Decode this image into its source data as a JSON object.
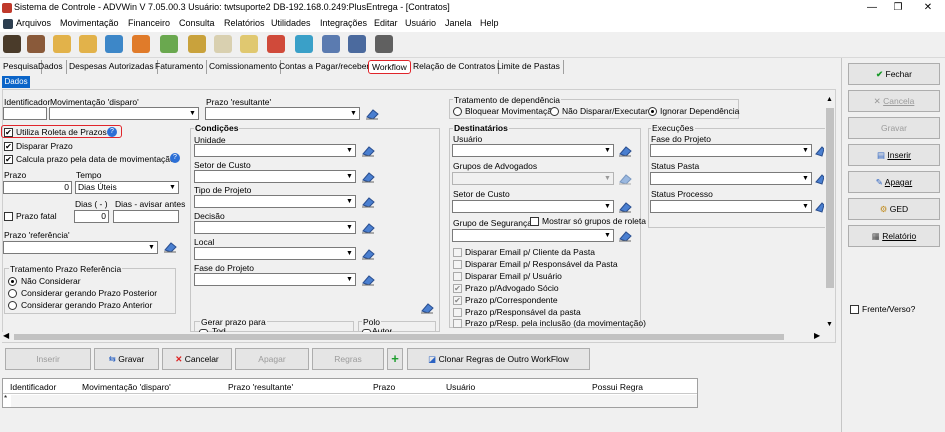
{
  "window": {
    "title": "Sistema de Controle - ADVWin  V 7.05.00.3  Usuário: twtsuporte2  DB-192.168.0.249:PlusEntrega - [Contratos]",
    "minimize": "—",
    "restore": "❐",
    "close": "✕"
  },
  "menu": [
    "Arquivos",
    "Movimentação",
    "Financeiro",
    "Consulta",
    "Relatórios",
    "Utilidades",
    "Integrações",
    "Editar",
    "Usuário",
    "Janela",
    "Help"
  ],
  "tabs": [
    "Pesquisa",
    "Dados",
    "Despesas Autorizadas",
    "Faturamento",
    "Comissionamento",
    "Contas a Pagar/receber",
    "Workflow",
    "Relação de Contratos",
    "Limite de Pastas"
  ],
  "subtab": "Dados",
  "form": {
    "identificador": "Identificador",
    "mov_disparo": "Movimentação 'disparo'",
    "prazo_resultante": "Prazo 'resultante'",
    "utiliza_roleta": "Utiliza Roleta de Prazos",
    "disparar_prazo": "Disparar Prazo",
    "calcula_prazo": "Calcula prazo pela data de movimentação",
    "prazo": "Prazo",
    "prazo_value": "0",
    "tempo": "Tempo",
    "tempo_value": "Dias Úteis",
    "dias_menos": "Dias ( - )",
    "dias_menos_value": "0",
    "dias_avisar": "Dias - avisar antes",
    "prazo_fatal": "Prazo fatal",
    "prazo_referencia": "Prazo 'referência'",
    "trat_ref_title": "Tratamento Prazo Referência",
    "trat_ref_options": [
      "Não Considerar",
      "Considerar gerando Prazo Posterior",
      "Considerar gerando Prazo Anterior"
    ]
  },
  "condicoes": {
    "title": "Condições",
    "labels": [
      "Unidade",
      "Setor de Custo",
      "Tipo de Projeto",
      "Decisão",
      "Local",
      "Fase do Projeto"
    ],
    "gerar_prazo": "Gerar prazo para",
    "gerar_first": "Tod",
    "polo": "Polo",
    "polo_first": "Autor"
  },
  "dependencia": {
    "title": "Tratamento de dependência",
    "options": [
      "Bloquear Movimentação",
      "Não Disparar/Executar",
      "Ignorar Dependência"
    ]
  },
  "destinatarios": {
    "title": "Destinatários",
    "usuario": "Usuário",
    "grupos": "Grupos de Advogados",
    "setor": "Setor de Custo",
    "grupo_seg": "Grupo de Segurança",
    "mostrar_roleta": "Mostrar só grupos de roleta",
    "checks": [
      {
        "label": "Disparar Email p/ Cliente da Pasta",
        "mark": ""
      },
      {
        "label": "Disparar Email p/ Responsável da Pasta",
        "mark": ""
      },
      {
        "label": "Disparar Email p/ Usuário",
        "mark": ""
      },
      {
        "label": "Prazo p/Advogado Sócio",
        "mark": "✔"
      },
      {
        "label": "Prazo p/Correspondente",
        "mark": "✔"
      },
      {
        "label": "Prazo p/Responsável da pasta",
        "mark": ""
      },
      {
        "label": "Prazo p/Resp. pela inclusão (da movimentação)",
        "mark": ""
      }
    ]
  },
  "execucoes": {
    "title": "Execuções",
    "labels": [
      "Fase do Projeto",
      "Status Pasta",
      "Status Processo"
    ]
  },
  "buttons": {
    "inserir": "Inserir",
    "gravar": "Gravar",
    "cancelar": "Cancelar",
    "apagar": "Apagar",
    "regras": "Regras",
    "plus": "+",
    "clonar": "Clonar Regras de Outro WorkFlow"
  },
  "grid": {
    "columns": [
      "Identificador",
      "Movimentação 'disparo'",
      "Prazo 'resultante'",
      "Prazo",
      "Usuário",
      "Possui Regra"
    ],
    "row_marker": "*"
  },
  "right_panel": {
    "fechar": "Fechar",
    "cancela": "Cancela",
    "gravar": "Gravar",
    "inserir": "Inserir",
    "apagar": "Apagar",
    "ged": "GED",
    "relatorio": "Relatório",
    "frente_verso": "Frente/Verso?"
  },
  "colors": {
    "accent_blue": "#0a64c8",
    "highlight_red": "#e0252b"
  }
}
